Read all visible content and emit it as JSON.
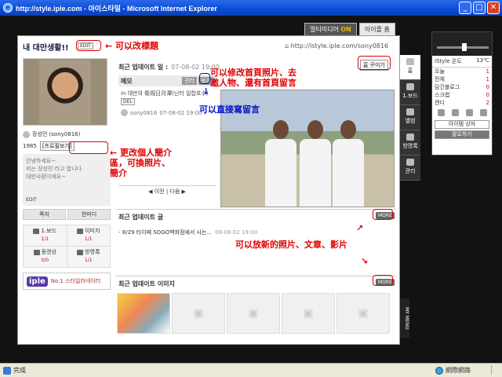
{
  "window": {
    "title": "http://style.iple.com - 아이스타일 - Microsoft Internet Explorer",
    "buttons": {
      "minimize": "_",
      "maximize": "□",
      "close": "✕"
    }
  },
  "top_tabs": {
    "media_label": "멀티미디어",
    "media_state": "ON",
    "home_label": "아이플 홈"
  },
  "blog": {
    "title": "내 대만생활!!",
    "edit_label": "EDIT",
    "url": "http://istyle.iple.com/sony0816"
  },
  "profile": {
    "name": "장성민 (sony0816)",
    "birth_year": "1985",
    "profile_link": "[프로필보기]",
    "intro_lines": [
      "안녕하세요~",
      "저는 장성민 라고 합니다.",
      "대만사람이에요~"
    ],
    "intro_edit": "EDIT",
    "message_btn": "쪽지",
    "minidi_btn": "현미디",
    "stats": [
      {
        "label": "1.보드",
        "count": "1/1"
      },
      {
        "label": "이미지",
        "count": "1/1"
      },
      {
        "label": "동영상",
        "count": "0/0"
      },
      {
        "label": "방명록",
        "count": "1/1"
      }
    ],
    "banner_logo": "iple",
    "banner_slogan": "No.1 스타일러네이터"
  },
  "updates": {
    "header": "최근 업데이트 일 :",
    "header_date": "07-08-02 19:00",
    "home_edit_btn": "홈 꾸미기",
    "memo_title": "메모",
    "memo_manage": "관리",
    "memo_write": "쓰기",
    "memo_text": "in 대만의 衛視日月潭(닌터 일합호수)",
    "memo_del": "DEL",
    "memo_user": "sony0816",
    "memo_date": "07-08-02 19:00",
    "pager_prev": "이전",
    "pager_next": "다음",
    "recent_posts_title": "최근 업데이트 글",
    "recent_post": "- 8/29 타이페 SOGO백화점에서 사는...",
    "recent_post_date": "08-08-02 19:00",
    "recent_images_title": "최근 업데이트 이미지",
    "more_label": "MORE"
  },
  "side_menu": [
    {
      "label": "홈"
    },
    {
      "label": "1.보드"
    },
    {
      "label": "앨범"
    },
    {
      "label": "방명록"
    },
    {
      "label": "관리"
    }
  ],
  "my_menu": "MY MENU",
  "widget": {
    "header_label": "iStyle 온도",
    "temperature": "13℃",
    "rows": [
      {
        "k": "오늘",
        "v": "1"
      },
      {
        "k": "전체",
        "v": "1"
      },
      {
        "k": "담긴블로그",
        "v": "0"
      },
      {
        "k": "스크랩",
        "v": "0"
      },
      {
        "k": "캔디",
        "v": "2"
      }
    ],
    "btn_shop": "아이템 상자",
    "btn_follow": "팔로하기"
  },
  "annotations": {
    "edit_title": "可以改標題",
    "edit_photo_l1": "可以修改首頁照片、去",
    "edit_photo_l2": "邀人物、還有首頁留言",
    "write_direct": "可以直接寫留言",
    "profile_l1": "更改個人簡介",
    "profile_l2": "區，可換照片、",
    "profile_l3": "簡介",
    "new_content": "可以放新的照片、文章、影片"
  },
  "status": {
    "text": "完成",
    "zone": "網際網路"
  },
  "colors": {
    "title_bar": "#0a4bd6",
    "annotation_red": "#e00000",
    "annotation_blue": "#0010c8"
  }
}
